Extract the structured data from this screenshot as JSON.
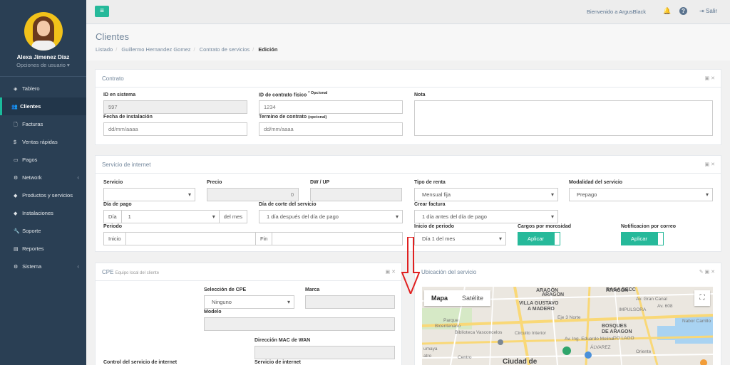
{
  "user": {
    "name": "Alexa Jimenez Díaz",
    "options": "Opciones de usuario ▾"
  },
  "sidebar": {
    "items": [
      {
        "label": "Tablero",
        "icon": "dashboard-icon",
        "glyph": "◈"
      },
      {
        "label": "Clientes",
        "icon": "users-icon",
        "glyph": "👥"
      },
      {
        "label": "Facturas",
        "icon": "file-icon",
        "glyph": "🗋"
      },
      {
        "label": "Ventas rápidas",
        "icon": "dollar-icon",
        "glyph": "$"
      },
      {
        "label": "Pagos",
        "icon": "money-icon",
        "glyph": "▭"
      },
      {
        "label": "Network",
        "icon": "gear-icon",
        "glyph": "⚙"
      },
      {
        "label": "Productos y servicios",
        "icon": "tag-icon",
        "glyph": "◆"
      },
      {
        "label": "Instalaciones",
        "icon": "tag-icon",
        "glyph": "◆"
      },
      {
        "label": "Soporte",
        "icon": "wrench-icon",
        "glyph": "🔧"
      },
      {
        "label": "Reportes",
        "icon": "book-icon",
        "glyph": "▤"
      },
      {
        "label": "Sistema",
        "icon": "gears-icon",
        "glyph": "⚙"
      }
    ]
  },
  "topbar": {
    "welcome": "Bienvenido a ArgusBlack",
    "logout": "Salir"
  },
  "page": {
    "title": "Clientes",
    "breadcrumb": [
      "Listado",
      "Guillermo Hernandez Gomez",
      "Contrato de servicios"
    ],
    "breadcrumb_current": "Edición"
  },
  "contrato": {
    "title": "Contrato",
    "id_sistema_label": "ID en sistema",
    "id_sistema_value": "597",
    "id_fisico_label": "ID de contrato físico",
    "id_fisico_note": "* Opcional",
    "id_fisico_placeholder": "1234",
    "nota_label": "Nota",
    "fecha_label": "Fecha de instalación",
    "fecha_placeholder": "dd/mm/aaaa",
    "termino_label": "Termino de contrato",
    "termino_note": "(opcional)",
    "termino_placeholder": "dd/mm/aaaa"
  },
  "internet": {
    "title": "Servicio de internet",
    "servicio_label": "Servicio",
    "precio_label": "Precio",
    "precio_value": "0",
    "dwup_label": "DW / UP",
    "renta_label": "Tipo de renta",
    "renta_value": "Mensual fija",
    "modalidad_label": "Modalidad del servicio",
    "modalidad_value": "Prepago",
    "dia_pago_label": "Día de pago",
    "dia_addon": "Día",
    "dia_value": "1",
    "del_mes": "del mes",
    "corte_label": "Día de corte del servicio",
    "corte_value": "1 día después del día de pago",
    "crear_label": "Crear factura",
    "crear_value": "1 día antes del día de pago",
    "periodo_label": "Periodo",
    "inicio_addon": "Inicio",
    "fin_addon": "Fin",
    "inicio_periodo_label": "Inicio de periodo",
    "inicio_periodo_value": "Día 1 del mes",
    "cargos_label": "Cargos por morosidad",
    "cargos_btn": "Aplicar",
    "notif_label": "Notificacion por correo",
    "notif_btn": "Aplicar"
  },
  "cpe": {
    "title": "CPE",
    "subtitle": "Equipo local del cliente",
    "seleccion_label": "Selección de CPE",
    "seleccion_value": "Ninguno",
    "marca_label": "Marca",
    "modelo_label": "Modelo",
    "mac_label": "Dirección MAC de WAN",
    "control_label": "Control del servicio de internet",
    "servicio_label": "Servicio de internet"
  },
  "ubicacion": {
    "title": "Ubicación del servicio",
    "map_tab_map": "Mapa",
    "map_tab_sat": "Satélite",
    "places": [
      "ARAGÓN",
      "ARAGÓN",
      "ARAGON",
      "RAGA SECC",
      "VILLA GUSTAVO",
      "A MADERO",
      "Parque",
      "Bicentenario",
      "Biblioteca Vasconcelos",
      "IMPULSORA",
      "BOSQUES",
      "DE ARAGON",
      "Ciudad de",
      "Nabor Carrillo",
      "DO LAGO",
      "ÁLVAREZ",
      "umaya",
      "atro",
      "Centro",
      "Oriente",
      "Eje 3 Norte",
      "Circuito Interior",
      "Av. Ing. Eduardo Molina",
      "Av. Gran Canal",
      "Av. 608"
    ]
  }
}
